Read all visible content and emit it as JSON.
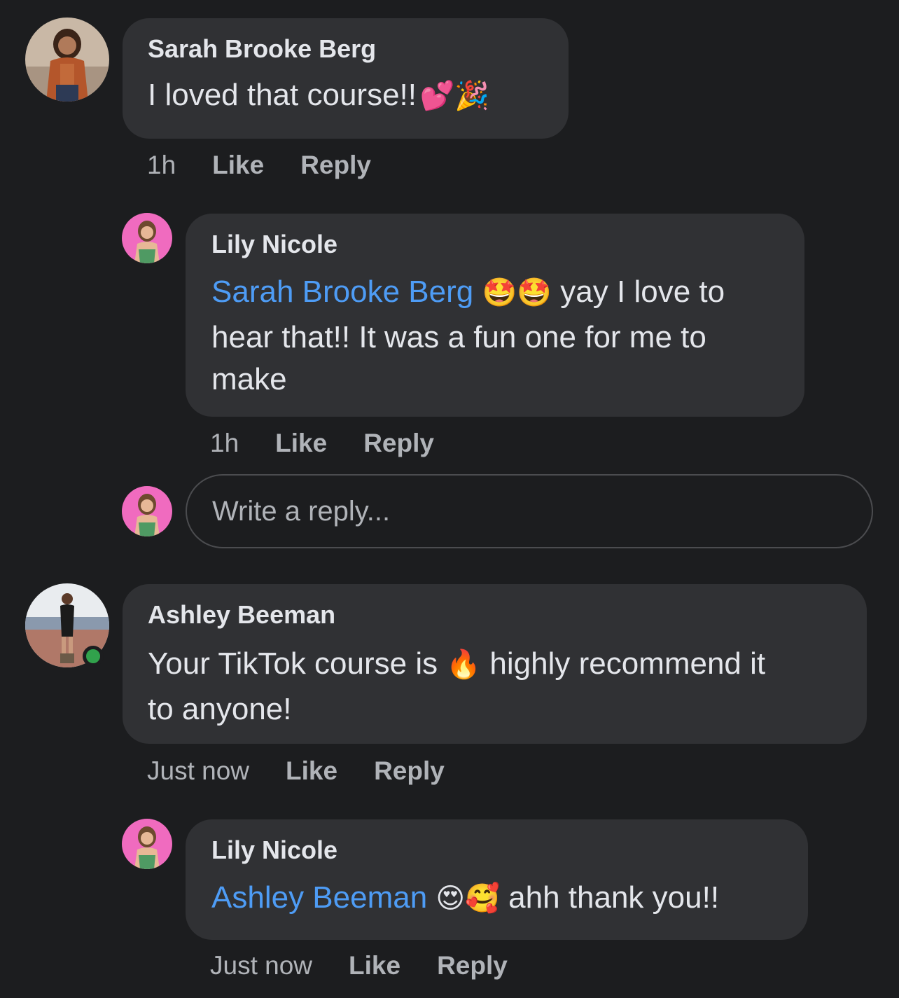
{
  "comments": [
    {
      "author": "Sarah Brooke Berg",
      "text": "I loved that course!!",
      "emojis": "💕🎉",
      "time": "1h",
      "like_label": "Like",
      "reply_label": "Reply"
    },
    {
      "author": "Lily Nicole",
      "mention": "Sarah Brooke Berg",
      "emojis": "🤩🤩",
      "text_line1": "yay I love to",
      "text_line2": "hear that!! It was a fun one for me to",
      "text_line3": "make",
      "time": "1h",
      "like_label": "Like",
      "reply_label": "Reply"
    },
    {
      "author": "Ashley Beeman",
      "text_before": "Your TikTok course is",
      "emoji": "🔥",
      "text_after": "highly recommend it",
      "text_line2": "to anyone!",
      "time": "Just now",
      "like_label": "Like",
      "reply_label": "Reply"
    },
    {
      "author": "Lily Nicole",
      "mention": "Ashley Beeman",
      "emojis": "😍🥰",
      "text": "ahh thank you!!",
      "time": "Just now",
      "like_label": "Like",
      "reply_label": "Reply"
    }
  ],
  "reply_box": {
    "placeholder": "Write a reply..."
  },
  "colors": {
    "background": "#1c1d1f",
    "bubble": "#303134",
    "mention": "#4e9cf5",
    "online": "#31a24c"
  }
}
